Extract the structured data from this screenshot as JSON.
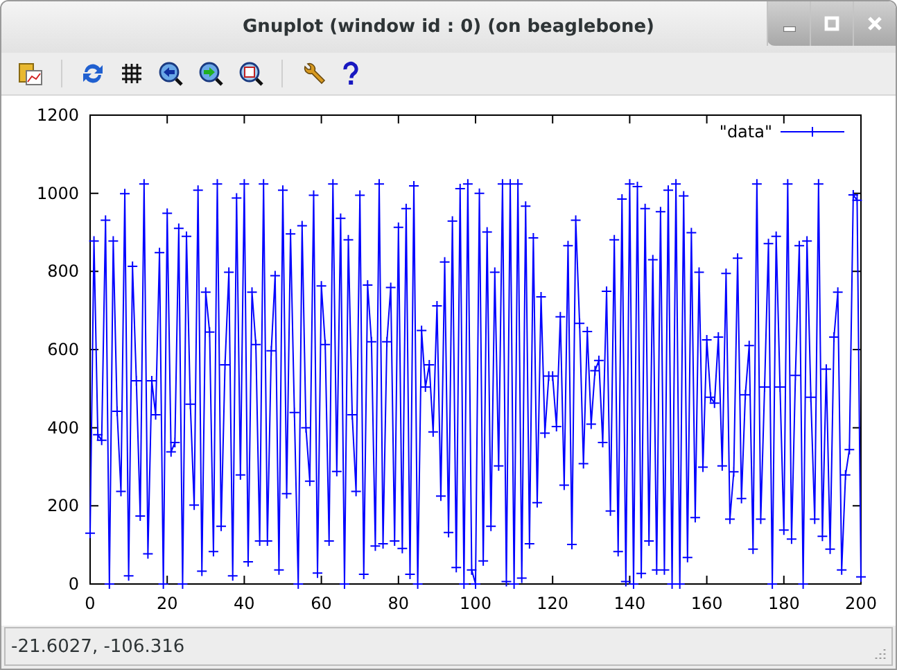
{
  "window": {
    "title": "Gnuplot (window id : 0) (on beaglebone)"
  },
  "plot": {
    "chart_data": {
      "type": "line",
      "x": [
        0,
        1,
        2,
        3,
        4,
        5,
        6,
        7,
        8,
        9,
        10,
        11,
        12,
        13,
        14,
        15,
        16,
        17,
        18,
        19,
        20,
        21,
        22,
        23,
        24,
        25,
        26,
        27,
        28,
        29,
        30,
        31,
        32,
        33,
        34,
        35,
        36,
        37,
        38,
        39,
        40,
        41,
        42,
        43,
        44,
        45,
        46,
        47,
        48,
        49,
        50,
        51,
        52,
        53,
        54,
        55,
        56,
        57,
        58,
        59,
        60,
        61,
        62,
        63,
        64,
        65,
        66,
        67,
        68,
        69,
        70,
        71,
        72,
        73,
        74,
        75,
        76,
        77,
        78,
        79,
        80,
        81,
        82,
        83,
        84,
        85,
        86,
        87,
        88,
        89,
        90,
        91,
        92,
        93,
        94,
        95,
        96,
        97,
        98,
        99,
        100,
        101,
        102,
        103,
        104,
        105,
        106,
        107,
        108,
        109,
        110,
        111,
        112,
        113,
        114,
        115,
        116,
        117,
        118,
        119,
        120,
        121,
        122,
        123,
        124,
        125,
        126,
        127,
        128,
        129,
        130,
        131,
        132,
        133,
        134,
        135,
        136,
        137,
        138,
        139,
        140,
        141,
        142,
        143,
        144,
        145,
        146,
        147,
        148,
        149,
        150,
        151,
        152,
        153,
        154,
        155,
        156,
        157,
        158,
        159,
        160,
        161,
        162,
        163,
        164,
        165,
        166,
        167,
        168,
        169,
        170,
        171,
        172,
        173,
        174,
        175,
        176,
        177,
        178,
        179,
        180,
        181,
        182,
        183,
        184,
        185,
        186,
        187,
        188,
        189,
        190,
        191,
        192,
        193,
        194,
        195,
        196,
        197,
        198,
        199,
        200
      ],
      "xlim": [
        0,
        200
      ],
      "ylim": [
        0,
        1200
      ],
      "xticks": [
        0,
        20,
        40,
        60,
        80,
        100,
        120,
        140,
        160,
        180,
        200
      ],
      "yticks": [
        0,
        200,
        400,
        600,
        800,
        1000,
        1200
      ],
      "series": [
        {
          "name": "\"data\"",
          "color": "#0000ff",
          "marker": "+",
          "values": [
            130,
            878,
            382,
            368,
            931,
            0,
            878,
            442,
            237,
            999,
            21,
            813,
            520,
            174,
            1024,
            77,
            520,
            433,
            848,
            0,
            949,
            338,
            362,
            910,
            0,
            890,
            460,
            202,
            1008,
            33,
            747,
            645,
            83,
            1024,
            148,
            561,
            798,
            21,
            988,
            279,
            1024,
            57,
            747,
            613,
            110,
            1024,
            110,
            597,
            789,
            36,
            1008,
            231,
            896,
            439,
            0,
            917,
            400,
            263,
            995,
            28,
            763,
            613,
            110,
            1024,
            288,
            936,
            0,
            881,
            433,
            237,
            995,
            25,
            765,
            620,
            97,
            1024,
            103,
            620,
            759,
            110,
            913,
            91,
            961,
            25,
            1019,
            0,
            649,
            504,
            561,
            389,
            712,
            225,
            824,
            132,
            929,
            42,
            1012,
            0,
            1024,
            36,
            0,
            1000,
            59,
            901,
            148,
            798,
            302,
            1024,
            6,
            1024,
            0,
            1024,
            15,
            967,
            103,
            886,
            208,
            735,
            386,
            532,
            532,
            403,
            684,
            253,
            866,
            101,
            931,
            667,
            308,
            646,
            409,
            546,
            572,
            362,
            749,
            187,
            881,
            83,
            985,
            6,
            1024,
            0,
            1017,
            27,
            961,
            110,
            830,
            36,
            953,
            36,
            1008,
            0,
            1024,
            0,
            993,
            68,
            899,
            170,
            798,
            299,
            625,
            478,
            463,
            632,
            302,
            795,
            166,
            287,
            834,
            219,
            484,
            610,
            89,
            1024,
            166,
            504,
            871,
            0,
            890,
            504,
            138,
            1024,
            115,
            534,
            866,
            0,
            878,
            478,
            166,
            1024,
            122,
            550,
            89,
            632,
            747,
            36,
            279,
            344,
            996,
            982,
            18
          ]
        }
      ]
    }
  },
  "status_bar": {
    "text": "-21.6027, -106.316"
  }
}
